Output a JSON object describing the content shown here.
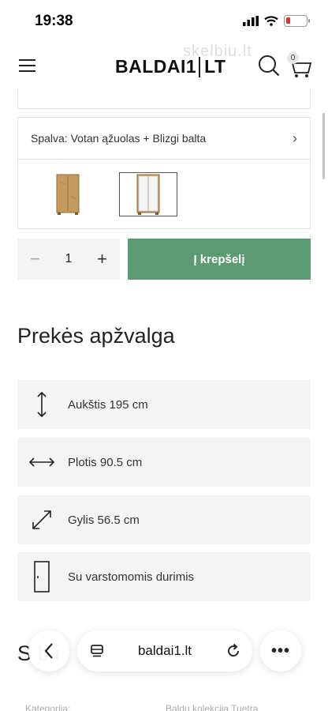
{
  "status": {
    "time": "19:38"
  },
  "header": {
    "logo_left": "BALDAI1",
    "logo_right": "LT",
    "watermark": "skelbiu.lt",
    "cart_count": "0"
  },
  "variant": {
    "label": "Spalva:",
    "value": "Votan ąžuolas + Blizgi balta"
  },
  "quantity": {
    "value": "1",
    "minus": "−",
    "plus": "+"
  },
  "add_to_cart_label": "Į krepšelį",
  "overview": {
    "title": "Prekės apžvalga",
    "features": [
      {
        "icon": "height-arrow-icon",
        "label": "Aukštis 195 cm"
      },
      {
        "icon": "width-arrow-icon",
        "label": "Plotis 90.5 cm"
      },
      {
        "icon": "depth-arrow-icon",
        "label": "Gylis 56.5 cm"
      },
      {
        "icon": "door-icon",
        "label": "Su varstomomis durimis"
      }
    ]
  },
  "next_section_title_partial": "S        b                      i",
  "footer_partial": {
    "left": "Kategorija:",
    "right": "Baldų kolekcija Tuetra"
  },
  "browser": {
    "url": "baldai1.lt"
  },
  "colors": {
    "accent_green": "#5c9a72",
    "panel_grey": "#f4f4f4"
  }
}
